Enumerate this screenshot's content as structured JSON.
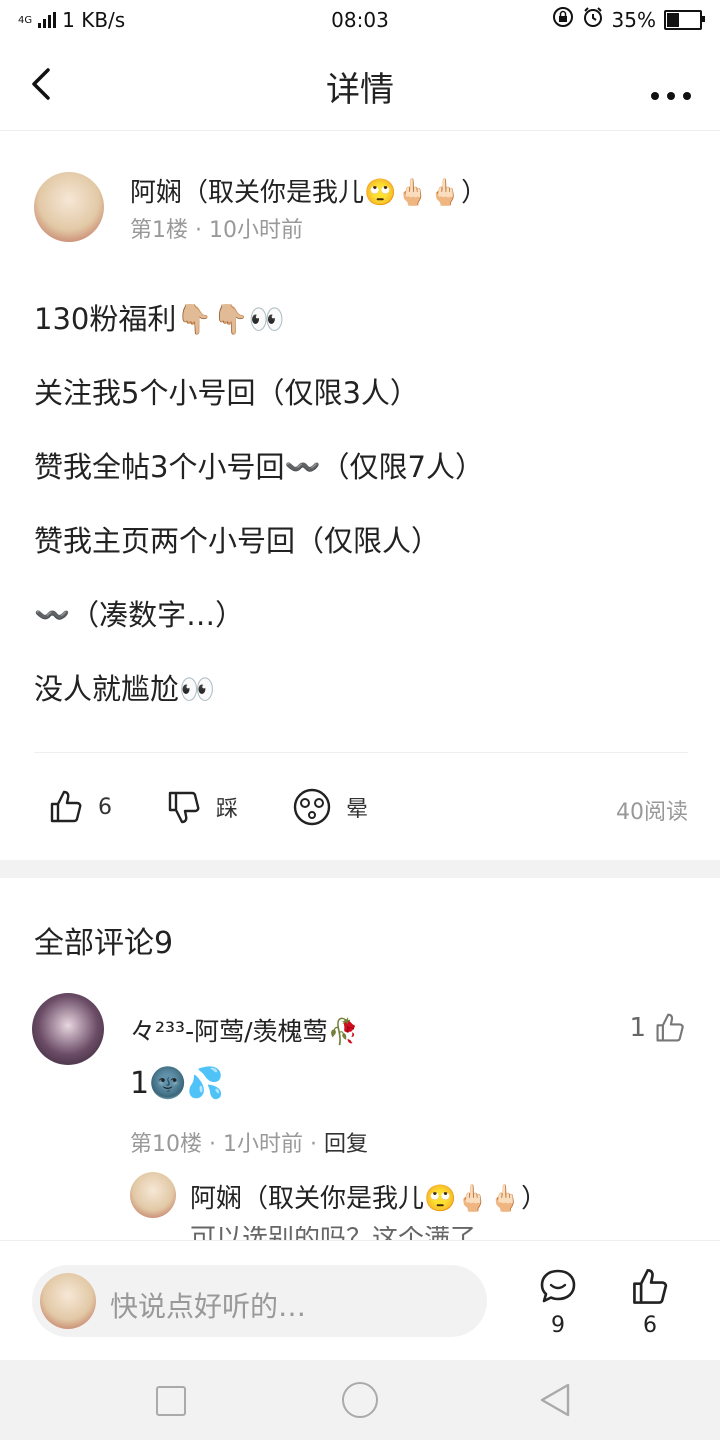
{
  "status_bar": {
    "network": "4G",
    "speed": "1 KB/s",
    "time": "08:03",
    "battery": "35%",
    "battery_level": 0.35
  },
  "header": {
    "title": "详情"
  },
  "post": {
    "author": "阿娴（取关你是我儿🙄🖕🏻🖕🏻）",
    "floor": "第1楼",
    "time": "10小时前",
    "lines": [
      " 130粉福利👇🏼👇🏼👀",
      "关注我5个小号回（仅限3人）",
      "赞我全帖3个小号回〰️（仅限7人）",
      "赞我主页两个小号回（仅限人）",
      "〰️（凑数字…）",
      "没人就尴尬👀"
    ],
    "likes": "6",
    "dislike_label": "踩",
    "dizzy_label": "晕",
    "reads": "40阅读"
  },
  "comments": {
    "heading": "全部评论9",
    "items": [
      {
        "name": "々²³³-阿莺/羡槐莺🥀",
        "likes": "1",
        "text": "1🌚💦",
        "floor": "第10楼",
        "time": "1小时前",
        "reply_label": "回复",
        "reply": {
          "name": "阿娴（取关你是我儿🙄🖕🏻🖕🏻）",
          "text": "可以选别的吗？这个满了"
        }
      }
    ]
  },
  "bottom_bar": {
    "placeholder": "快说点好听的…",
    "comment_count": "9",
    "like_count": "6"
  },
  "colors": {
    "accent": "#222222",
    "muted": "#999999",
    "divider": "#eeeeee"
  }
}
